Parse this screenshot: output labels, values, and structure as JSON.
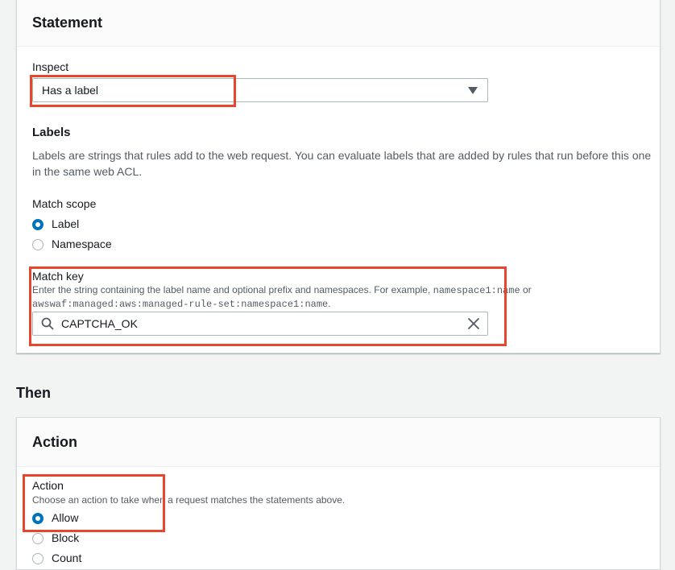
{
  "statement": {
    "title": "Statement",
    "inspect_label": "Inspect",
    "inspect_value": "Has a label",
    "labels_heading": "Labels",
    "labels_description": "Labels are strings that rules add to the web request. You can evaluate labels that are added by rules that run before this one in the same web ACL.",
    "match_scope_label": "Match scope",
    "match_scope_options": [
      {
        "label": "Label",
        "selected": true
      },
      {
        "label": "Namespace",
        "selected": false
      }
    ],
    "match_key_label": "Match key",
    "match_key_description_prefix": "Enter the string containing the label name and optional prefix and namespaces. For example, ",
    "match_key_example_1": "namespace1:name",
    "match_key_description_or": " or",
    "match_key_example_2": "awswaf:managed:aws:managed-rule-set:namespace1:name",
    "match_key_description_end": ".",
    "match_key_value": "CAPTCHA_OK"
  },
  "then_heading": "Then",
  "action": {
    "title": "Action",
    "action_label": "Action",
    "action_description": "Choose an action to take when a request matches the statements above.",
    "options": [
      {
        "label": "Allow",
        "selected": true
      },
      {
        "label": "Block",
        "selected": false
      },
      {
        "label": "Count",
        "selected": false
      }
    ]
  },
  "colors": {
    "highlight": "#e8452c",
    "radio_selected": "#0073bb",
    "background": "#f2f3f3"
  },
  "icons": [
    "dropdown-caret-icon",
    "search-icon",
    "clear-icon"
  ]
}
